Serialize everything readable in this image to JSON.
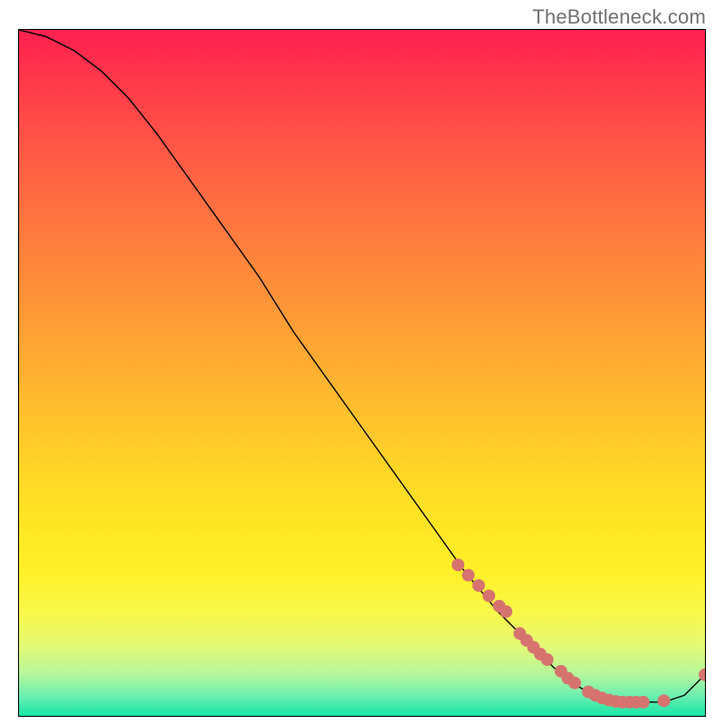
{
  "watermark": "TheBottleneck.com",
  "chart_data": {
    "type": "line",
    "title": "",
    "xlabel": "",
    "ylabel": "",
    "xlim": [
      0,
      100
    ],
    "ylim": [
      0,
      100
    ],
    "grid": false,
    "legend": false,
    "series": [
      {
        "name": "bottleneck-curve",
        "x": [
          0,
          4,
          8,
          12,
          16,
          20,
          25,
          30,
          35,
          40,
          45,
          50,
          55,
          60,
          65,
          70,
          73,
          76,
          79,
          82,
          85,
          88,
          91,
          94,
          97,
          100
        ],
        "y": [
          100,
          99,
          97,
          94,
          90,
          85,
          78,
          71,
          64,
          56,
          49,
          42,
          35,
          28,
          21,
          15,
          12,
          9,
          6,
          4,
          3,
          2,
          2,
          2,
          3,
          6
        ]
      }
    ],
    "markers": [
      {
        "x": 64.0,
        "y": 22.0
      },
      {
        "x": 65.5,
        "y": 20.5
      },
      {
        "x": 67.0,
        "y": 19.0
      },
      {
        "x": 68.5,
        "y": 17.5
      },
      {
        "x": 70.0,
        "y": 16.0
      },
      {
        "x": 71.0,
        "y": 15.2
      },
      {
        "x": 73.0,
        "y": 12.0
      },
      {
        "x": 74.0,
        "y": 11.0
      },
      {
        "x": 75.0,
        "y": 10.0
      },
      {
        "x": 76.0,
        "y": 9.0
      },
      {
        "x": 77.0,
        "y": 8.2
      },
      {
        "x": 79.0,
        "y": 6.5
      },
      {
        "x": 80.0,
        "y": 5.5
      },
      {
        "x": 81.0,
        "y": 4.8
      },
      {
        "x": 83.0,
        "y": 3.5
      },
      {
        "x": 84.0,
        "y": 3.0
      },
      {
        "x": 85.0,
        "y": 2.6
      },
      {
        "x": 86.0,
        "y": 2.3
      },
      {
        "x": 87.0,
        "y": 2.1
      },
      {
        "x": 88.0,
        "y": 2.0
      },
      {
        "x": 89.0,
        "y": 2.0
      },
      {
        "x": 90.0,
        "y": 2.0
      },
      {
        "x": 91.0,
        "y": 2.0
      },
      {
        "x": 94.0,
        "y": 2.2
      },
      {
        "x": 100.0,
        "y": 6.0
      }
    ],
    "marker_radius": 7
  }
}
